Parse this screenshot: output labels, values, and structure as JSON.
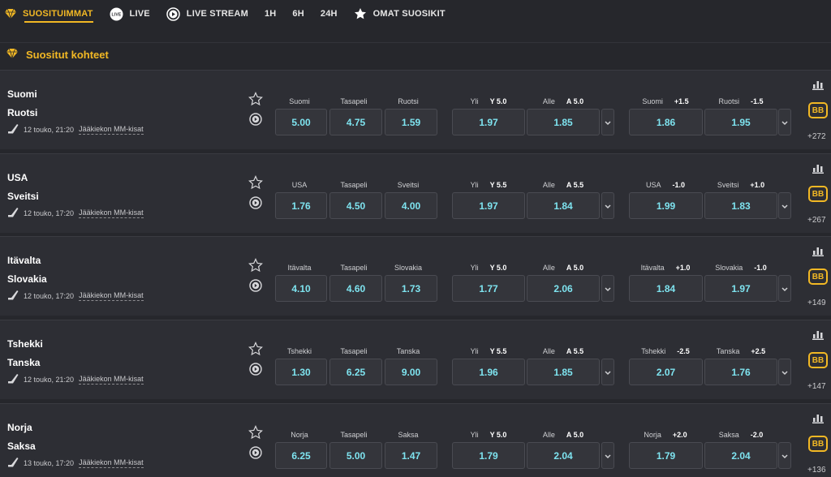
{
  "nav": {
    "popular": "SUOSITUIMMAT",
    "live_badge": "LIVE",
    "live": "LIVE",
    "live_stream": "LIVE STREAM",
    "h1": "1H",
    "h6": "6H",
    "h24": "24H",
    "favourites": "OMAT SUOSIKIT"
  },
  "section": {
    "title": "Suositut kohteet"
  },
  "colors": {
    "accent": "#f2b824",
    "odds": "#7ee3ef"
  },
  "matches": [
    {
      "home": "Suomi",
      "away": "Ruotsi",
      "date": "12 touko,  21:20",
      "league": "Jääkiekon MM-kisat",
      "m1": {
        "home": "Suomi",
        "draw": "Tasapeli",
        "away": "Ruotsi",
        "o1": "5.00",
        "ox": "4.75",
        "o2": "1.59"
      },
      "tot": {
        "over": "Yli",
        "over_line": "Y 5.0",
        "under": "Alle",
        "under_line": "A 5.0",
        "o_over": "1.97",
        "o_under": "1.85"
      },
      "hcp": {
        "home": "Suomi",
        "home_line": "+1.5",
        "away": "Ruotsi",
        "away_line": "-1.5",
        "o_home": "1.86",
        "o_away": "1.95"
      },
      "more": "+272"
    },
    {
      "home": "USA",
      "away": "Sveitsi",
      "date": "12 touko,  17:20",
      "league": "Jääkiekon MM-kisat",
      "m1": {
        "home": "USA",
        "draw": "Tasapeli",
        "away": "Sveitsi",
        "o1": "1.76",
        "ox": "4.50",
        "o2": "4.00"
      },
      "tot": {
        "over": "Yli",
        "over_line": "Y 5.5",
        "under": "Alle",
        "under_line": "A 5.5",
        "o_over": "1.97",
        "o_under": "1.84"
      },
      "hcp": {
        "home": "USA",
        "home_line": "-1.0",
        "away": "Sveitsi",
        "away_line": "+1.0",
        "o_home": "1.99",
        "o_away": "1.83"
      },
      "more": "+267"
    },
    {
      "home": "Itävalta",
      "away": "Slovakia",
      "date": "12 touko,  17:20",
      "league": "Jääkiekon MM-kisat",
      "m1": {
        "home": "Itävalta",
        "draw": "Tasapeli",
        "away": "Slovakia",
        "o1": "4.10",
        "ox": "4.60",
        "o2": "1.73"
      },
      "tot": {
        "over": "Yli",
        "over_line": "Y 5.0",
        "under": "Alle",
        "under_line": "A 5.0",
        "o_over": "1.77",
        "o_under": "2.06"
      },
      "hcp": {
        "home": "Itävalta",
        "home_line": "+1.0",
        "away": "Slovakia",
        "away_line": "-1.0",
        "o_home": "1.84",
        "o_away": "1.97"
      },
      "more": "+149"
    },
    {
      "home": "Tshekki",
      "away": "Tanska",
      "date": "12 touko,  21:20",
      "league": "Jääkiekon MM-kisat",
      "m1": {
        "home": "Tshekki",
        "draw": "Tasapeli",
        "away": "Tanska",
        "o1": "1.30",
        "ox": "6.25",
        "o2": "9.00"
      },
      "tot": {
        "over": "Yli",
        "over_line": "Y 5.5",
        "under": "Alle",
        "under_line": "A 5.5",
        "o_over": "1.96",
        "o_under": "1.85"
      },
      "hcp": {
        "home": "Tshekki",
        "home_line": "-2.5",
        "away": "Tanska",
        "away_line": "+2.5",
        "o_home": "2.07",
        "o_away": "1.76"
      },
      "more": "+147"
    },
    {
      "home": "Norja",
      "away": "Saksa",
      "date": "13 touko,  17:20",
      "league": "Jääkiekon MM-kisat",
      "m1": {
        "home": "Norja",
        "draw": "Tasapeli",
        "away": "Saksa",
        "o1": "6.25",
        "ox": "5.00",
        "o2": "1.47"
      },
      "tot": {
        "over": "Yli",
        "over_line": "Y 5.0",
        "under": "Alle",
        "under_line": "A 5.0",
        "o_over": "1.79",
        "o_under": "2.04"
      },
      "hcp": {
        "home": "Norja",
        "home_line": "+2.0",
        "away": "Saksa",
        "away_line": "-2.0",
        "o_home": "1.79",
        "o_away": "2.04"
      },
      "more": "+136"
    }
  ],
  "bb_label": "BB"
}
